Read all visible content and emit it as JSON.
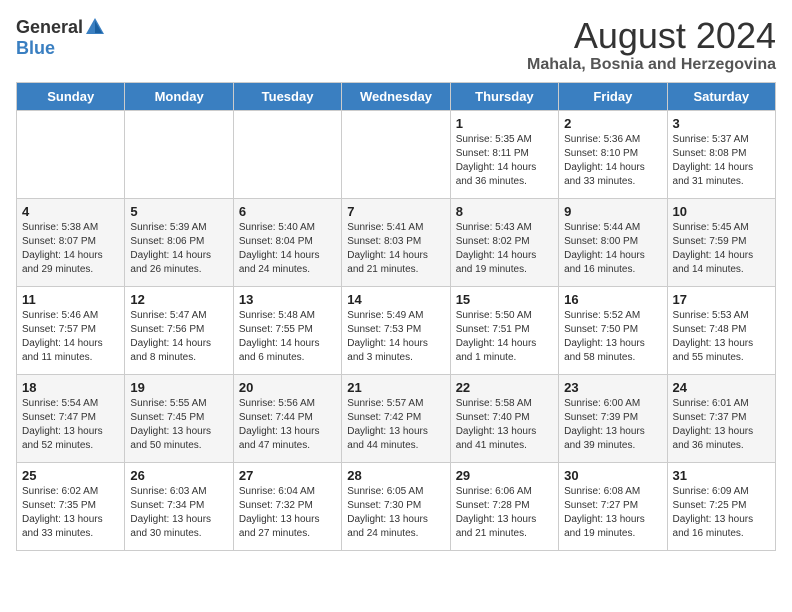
{
  "header": {
    "logo_general": "General",
    "logo_blue": "Blue",
    "month_year": "August 2024",
    "location": "Mahala, Bosnia and Herzegovina"
  },
  "weekdays": [
    "Sunday",
    "Monday",
    "Tuesday",
    "Wednesday",
    "Thursday",
    "Friday",
    "Saturday"
  ],
  "weeks": [
    [
      {
        "day": "",
        "info": ""
      },
      {
        "day": "",
        "info": ""
      },
      {
        "day": "",
        "info": ""
      },
      {
        "day": "",
        "info": ""
      },
      {
        "day": "1",
        "info": "Sunrise: 5:35 AM\nSunset: 8:11 PM\nDaylight: 14 hours\nand 36 minutes."
      },
      {
        "day": "2",
        "info": "Sunrise: 5:36 AM\nSunset: 8:10 PM\nDaylight: 14 hours\nand 33 minutes."
      },
      {
        "day": "3",
        "info": "Sunrise: 5:37 AM\nSunset: 8:08 PM\nDaylight: 14 hours\nand 31 minutes."
      }
    ],
    [
      {
        "day": "4",
        "info": "Sunrise: 5:38 AM\nSunset: 8:07 PM\nDaylight: 14 hours\nand 29 minutes."
      },
      {
        "day": "5",
        "info": "Sunrise: 5:39 AM\nSunset: 8:06 PM\nDaylight: 14 hours\nand 26 minutes."
      },
      {
        "day": "6",
        "info": "Sunrise: 5:40 AM\nSunset: 8:04 PM\nDaylight: 14 hours\nand 24 minutes."
      },
      {
        "day": "7",
        "info": "Sunrise: 5:41 AM\nSunset: 8:03 PM\nDaylight: 14 hours\nand 21 minutes."
      },
      {
        "day": "8",
        "info": "Sunrise: 5:43 AM\nSunset: 8:02 PM\nDaylight: 14 hours\nand 19 minutes."
      },
      {
        "day": "9",
        "info": "Sunrise: 5:44 AM\nSunset: 8:00 PM\nDaylight: 14 hours\nand 16 minutes."
      },
      {
        "day": "10",
        "info": "Sunrise: 5:45 AM\nSunset: 7:59 PM\nDaylight: 14 hours\nand 14 minutes."
      }
    ],
    [
      {
        "day": "11",
        "info": "Sunrise: 5:46 AM\nSunset: 7:57 PM\nDaylight: 14 hours\nand 11 minutes."
      },
      {
        "day": "12",
        "info": "Sunrise: 5:47 AM\nSunset: 7:56 PM\nDaylight: 14 hours\nand 8 minutes."
      },
      {
        "day": "13",
        "info": "Sunrise: 5:48 AM\nSunset: 7:55 PM\nDaylight: 14 hours\nand 6 minutes."
      },
      {
        "day": "14",
        "info": "Sunrise: 5:49 AM\nSunset: 7:53 PM\nDaylight: 14 hours\nand 3 minutes."
      },
      {
        "day": "15",
        "info": "Sunrise: 5:50 AM\nSunset: 7:51 PM\nDaylight: 14 hours\nand 1 minute."
      },
      {
        "day": "16",
        "info": "Sunrise: 5:52 AM\nSunset: 7:50 PM\nDaylight: 13 hours\nand 58 minutes."
      },
      {
        "day": "17",
        "info": "Sunrise: 5:53 AM\nSunset: 7:48 PM\nDaylight: 13 hours\nand 55 minutes."
      }
    ],
    [
      {
        "day": "18",
        "info": "Sunrise: 5:54 AM\nSunset: 7:47 PM\nDaylight: 13 hours\nand 52 minutes."
      },
      {
        "day": "19",
        "info": "Sunrise: 5:55 AM\nSunset: 7:45 PM\nDaylight: 13 hours\nand 50 minutes."
      },
      {
        "day": "20",
        "info": "Sunrise: 5:56 AM\nSunset: 7:44 PM\nDaylight: 13 hours\nand 47 minutes."
      },
      {
        "day": "21",
        "info": "Sunrise: 5:57 AM\nSunset: 7:42 PM\nDaylight: 13 hours\nand 44 minutes."
      },
      {
        "day": "22",
        "info": "Sunrise: 5:58 AM\nSunset: 7:40 PM\nDaylight: 13 hours\nand 41 minutes."
      },
      {
        "day": "23",
        "info": "Sunrise: 6:00 AM\nSunset: 7:39 PM\nDaylight: 13 hours\nand 39 minutes."
      },
      {
        "day": "24",
        "info": "Sunrise: 6:01 AM\nSunset: 7:37 PM\nDaylight: 13 hours\nand 36 minutes."
      }
    ],
    [
      {
        "day": "25",
        "info": "Sunrise: 6:02 AM\nSunset: 7:35 PM\nDaylight: 13 hours\nand 33 minutes."
      },
      {
        "day": "26",
        "info": "Sunrise: 6:03 AM\nSunset: 7:34 PM\nDaylight: 13 hours\nand 30 minutes."
      },
      {
        "day": "27",
        "info": "Sunrise: 6:04 AM\nSunset: 7:32 PM\nDaylight: 13 hours\nand 27 minutes."
      },
      {
        "day": "28",
        "info": "Sunrise: 6:05 AM\nSunset: 7:30 PM\nDaylight: 13 hours\nand 24 minutes."
      },
      {
        "day": "29",
        "info": "Sunrise: 6:06 AM\nSunset: 7:28 PM\nDaylight: 13 hours\nand 21 minutes."
      },
      {
        "day": "30",
        "info": "Sunrise: 6:08 AM\nSunset: 7:27 PM\nDaylight: 13 hours\nand 19 minutes."
      },
      {
        "day": "31",
        "info": "Sunrise: 6:09 AM\nSunset: 7:25 PM\nDaylight: 13 hours\nand 16 minutes."
      }
    ]
  ]
}
